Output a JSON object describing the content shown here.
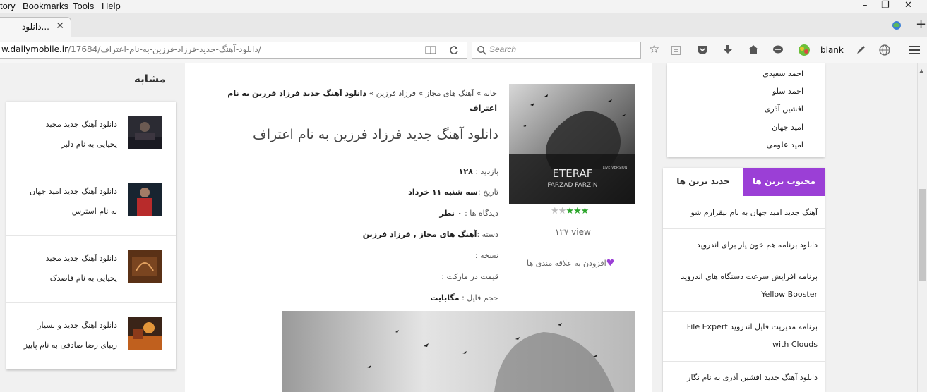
{
  "menu": [
    "tory",
    "Bookmarks",
    "Tools",
    "Help"
  ],
  "tab": {
    "title": "...دانلود",
    "close": "✕"
  },
  "url": {
    "domain": "w.dailymobile.ir",
    "path": "/17684/دانلود-آهنگ-جدید-فرزاد-فرزین-به-نام-اعتراف/"
  },
  "search": {
    "placeholder": "Search"
  },
  "toolbar": {
    "blank_label": "blank"
  },
  "similar": {
    "title": "مشابه",
    "items": [
      {
        "line1": "دانلود آهنگ جدید مجید",
        "line2": "یحیایی به نام دلبر"
      },
      {
        "line1": "دانلود آهنگ جدید امید جهان",
        "line2": "به نام استرس"
      },
      {
        "line1": "دانلود آهنگ جدید مجید",
        "line2": "یحیایی به نام قاصدک"
      },
      {
        "line1": "دانلود آهنگ جدید و بسیار",
        "line2": "زیبای رضا صادقی به نام پاییز"
      }
    ]
  },
  "post": {
    "breadcrumb": {
      "home": "خانه",
      "sep": "»",
      "cat1": "آهنگ های مجاز",
      "cat2": "فرزاد فرزین",
      "current": "دانلود آهنگ جدید فرزاد فرزین به نام اعتراف"
    },
    "title": "دانلود آهنگ جدید فرزاد فرزین به نام اعتراف",
    "cover_text": {
      "brand": "ETERAF",
      "artist": "FARZAD FARZIN",
      "live": "LIVE VERSION"
    },
    "rating": 3,
    "views": "۱۲۷ view",
    "fav_label": "افزودن به علاقه مندی ها",
    "meta": {
      "visits_label": "بازدید :",
      "visits": "۱۲۸",
      "date_label": "تاریخ :",
      "date": "سه شنبه ۱۱ خرداد",
      "comments_label": "دیدگاه ها :",
      "comments": "۰ نظر",
      "category_label": "دسته :",
      "category": "آهنگ های مجاز , فرزاد فرزین",
      "version_label": "نسخه :",
      "price_label": "قیمت در مارکت :",
      "size_label": "حجم فایل :",
      "size": "مگابایت"
    }
  },
  "singers": [
    "احمد سعیدی",
    "احمد سلو",
    "افشین آذری",
    "امید جهان",
    "امید علومی"
  ],
  "tabs": {
    "popular": "محبوب ترین ها",
    "newest": "جدید ترین ها"
  },
  "popular_items": [
    {
      "text": "آهنگ جدید امید جهان به نام بیقرارم شو"
    },
    {
      "text": "دانلود برنامه هم خون یار برای اندروید"
    },
    {
      "text": "برنامه افزایش سرعت دستگاه های اندروید Yellow Booster"
    },
    {
      "text": "برنامه مدیریت فایل اندروید File Expert with Clouds"
    },
    {
      "text": "دانلود آهنگ جدید افشین آذری به نام نگار"
    }
  ]
}
